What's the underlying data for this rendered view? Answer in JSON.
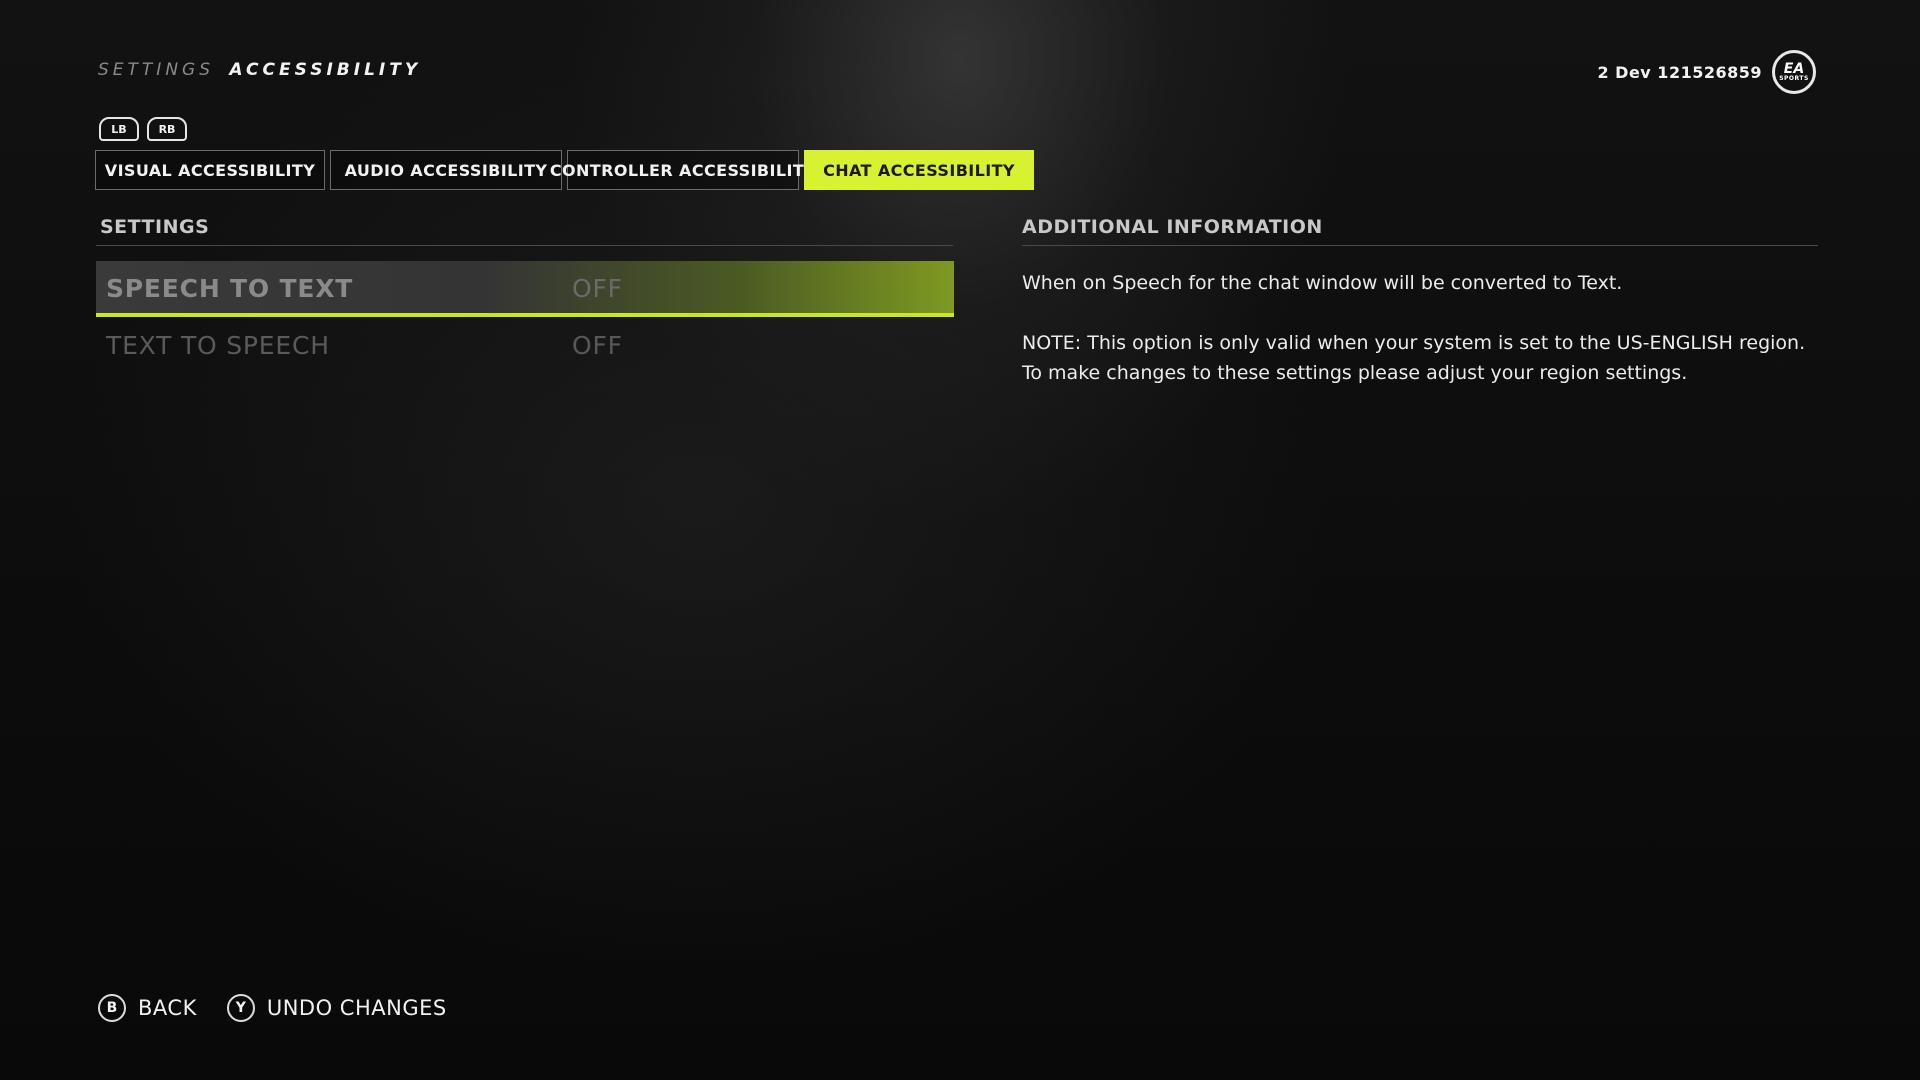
{
  "breadcrumb": {
    "parent": "SETTINGS",
    "current": "ACCESSIBILITY"
  },
  "user": {
    "id": "2 Dev 121526859",
    "logo_text": "EA",
    "logo_subtext": "SPORTS"
  },
  "bumpers": {
    "left": "LB",
    "right": "RB"
  },
  "tabs": [
    {
      "label": "VISUAL ACCESSIBILITY",
      "active": false
    },
    {
      "label": "AUDIO ACCESSIBILITY",
      "active": false
    },
    {
      "label": "CONTROLLER ACCESSIBILITY",
      "active": false
    },
    {
      "label": "CHAT ACCESSIBILITY",
      "active": true
    }
  ],
  "settings": {
    "heading": "SETTINGS",
    "items": [
      {
        "label": "SPEECH TO TEXT",
        "value": "OFF",
        "selected": true
      },
      {
        "label": "TEXT TO SPEECH",
        "value": "OFF",
        "selected": false
      }
    ]
  },
  "info": {
    "heading": "ADDITIONAL INFORMATION",
    "paragraphs": [
      "When on Speech for the chat window will be converted to Text.",
      "NOTE: This option is only valid when your system is set to the US-ENGLISH region. To make changes to these settings please adjust your region settings."
    ]
  },
  "footer": {
    "back": {
      "glyph": "B",
      "label": "BACK"
    },
    "undo": {
      "glyph": "Y",
      "label": "UNDO CHANGES"
    }
  },
  "colors": {
    "accent": "#d8f131",
    "background": "#0b0b0b"
  }
}
